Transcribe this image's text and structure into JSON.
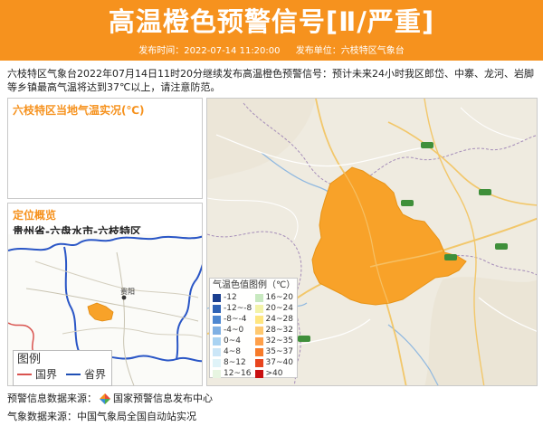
{
  "header": {
    "title": "高温橙色预警信号[Ⅱ/严重]",
    "publish_time": "发布时间：2022-07-14 11:20:00",
    "publisher": "发布单位：六枝特区气象台",
    "bg_color": "#f6921e"
  },
  "summary": "六枝特区气象台2022年07月14日11时20分继续发布高温橙色预警信号：预计未来24小时我区郎岱、中寨、龙河、岩脚等乡镇最高气温将达到37℃以上，请注意防范。",
  "temp_panel": {
    "title": "六枝特区当地气温实况(℃)"
  },
  "location_panel": {
    "title": "定位概览",
    "path": "贵州省-六盘水市-六枝特区",
    "city_label": "贵阳",
    "legend": {
      "title": "图例",
      "national_border": "国界",
      "provincial_border": "省界"
    }
  },
  "temp_legend": {
    "title": "气温色值图例（℃）",
    "items": [
      {
        "label": "-12",
        "color": "#1b3f8f"
      },
      {
        "label": "16~20",
        "color": "#c8e9c0"
      },
      {
        "label": "-12~-8",
        "color": "#2f63b5"
      },
      {
        "label": "20~24",
        "color": "#f3f3a8"
      },
      {
        "label": "-8~-4",
        "color": "#4d87d0"
      },
      {
        "label": "24~28",
        "color": "#ffe680"
      },
      {
        "label": "-4~0",
        "color": "#7fb0e3"
      },
      {
        "label": "28~32",
        "color": "#ffc970"
      },
      {
        "label": "0~4",
        "color": "#a9d3f2"
      },
      {
        "label": "32~35",
        "color": "#ffa04a"
      },
      {
        "label": "4~8",
        "color": "#cbe6f7"
      },
      {
        "label": "35~37",
        "color": "#f77b2a"
      },
      {
        "label": "8~12",
        "color": "#dff3f8"
      },
      {
        "label": "37~40",
        "color": "#e8451e"
      },
      {
        "label": "12~16",
        "color": "#e7f5e1"
      },
      {
        "label": ">40",
        "color": "#c81010"
      }
    ]
  },
  "sources": {
    "warning_source_prefix": "预警信息数据来源：",
    "warning_source": "国家预警信息发布中心",
    "weather_source": "气象数据来源：中国气象局全国自动站实况"
  },
  "colors": {
    "accent": "#f6921e",
    "warning_region": "#f8a229"
  }
}
